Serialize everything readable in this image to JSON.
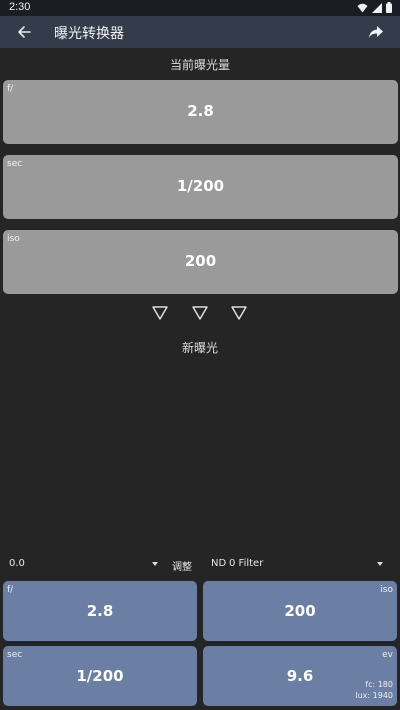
{
  "status_bar": {
    "time": "2:30"
  },
  "toolbar": {
    "title": "曝光转换器"
  },
  "current_exposure": {
    "title": "当前曝光量",
    "fields": [
      {
        "label": "f/",
        "value": "2.8"
      },
      {
        "label": "sec",
        "value": "1/200"
      },
      {
        "label": "iso",
        "value": "200"
      }
    ]
  },
  "new_exposure": {
    "title": "新曝光"
  },
  "controls": {
    "adjust_value": "0.0",
    "adjust_label": "调整",
    "nd_label": "ND",
    "nd_value": "0 Filter"
  },
  "results": {
    "f": {
      "label": "f/",
      "value": "2.8"
    },
    "iso": {
      "label": "iso",
      "value": "200"
    },
    "sec": {
      "label": "sec",
      "value": "1/200"
    },
    "ev": {
      "label": "ev",
      "value": "9.6",
      "fc": "fc: 180",
      "lux": "lux: 1940"
    }
  },
  "colors": {
    "background": "#252525",
    "toolbar": "#343c4b",
    "input_card": "#9a9a9a",
    "result_card": "#6a7fa3"
  }
}
